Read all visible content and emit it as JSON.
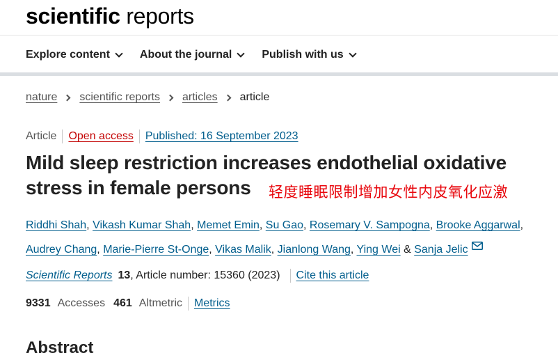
{
  "header": {
    "logo_bold": "scientific",
    "logo_light": "reports"
  },
  "nav": {
    "items": [
      {
        "label": "Explore content"
      },
      {
        "label": "About the journal"
      },
      {
        "label": "Publish with us"
      }
    ]
  },
  "breadcrumb": {
    "items": [
      "nature",
      "scientific reports",
      "articles"
    ],
    "current": "article"
  },
  "article": {
    "type": "Article",
    "access": "Open access",
    "published": "Published: 16 September 2023",
    "title_line1": "Mild sleep restriction increases endothelial oxidative",
    "title_line2": "stress in female persons",
    "annotation": "轻度睡眠限制增加女性内皮氧化应激",
    "authors_row1": [
      "Riddhi Shah",
      "Vikash Kumar Shah",
      "Memet Emin",
      "Su Gao",
      "Rosemary V. Sampogna",
      "Brooke Aggarwal"
    ],
    "authors_row2": [
      "Audrey Chang",
      "Marie-Pierre St-Onge",
      "Vikas Malik",
      "Jianlong Wang",
      "Ying Wei"
    ],
    "author_join": "&",
    "author_last": "Sanja Jelic",
    "citation": {
      "journal": "Scientific Reports",
      "volume": "13",
      "article_number": ", Article number: 15360 (2023)",
      "cite_label": "Cite this article"
    },
    "metrics": {
      "accesses_value": "9331",
      "accesses_label": "Accesses",
      "altmetric_value": "461",
      "altmetric_label": "Altmetric",
      "metrics_link": "Metrics"
    }
  },
  "sections": {
    "abstract_heading": "Abstract"
  },
  "colors": {
    "link": "#025e8d",
    "open_access": "#c40606",
    "annotation": "#e8060c"
  }
}
